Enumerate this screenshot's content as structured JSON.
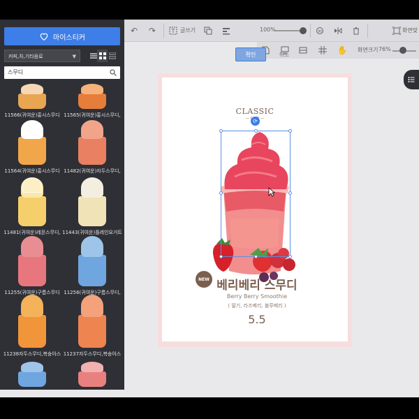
{
  "sidebar": {
    "sticker_button": "마이스티커",
    "category": "커피,차,기타음료",
    "search_value": "스무디",
    "items": [
      {
        "label": "11566(귀여운)홍시스무디",
        "top_color": "#f6d7b4",
        "body_color": "#e8a552"
      },
      {
        "label": "11565(귀여운)홍시스무디,",
        "top_color": "#f6b27a",
        "body_color": "#e67d3a"
      },
      {
        "label": "11564(귀여운)홍시스무디",
        "top_color": "#ffffff",
        "body_color": "#f2a64a"
      },
      {
        "label": "11482(귀여운)자두스무디,",
        "top_color": "#f2a48a",
        "body_color": "#e98062"
      },
      {
        "label": "11481(귀여운)레몬스무디,",
        "top_color": "#fbe7a6",
        "body_color": "#f5cf6b"
      },
      {
        "label": "11443(귀여운)플레인요거트",
        "top_color": "#f3eedf",
        "body_color": "#f1e3b8"
      },
      {
        "label": "11255(귀여운)구름스무디",
        "top_color": "#e88e92",
        "body_color": "#e7777c"
      },
      {
        "label": "11256(귀여운)구름스무디,",
        "top_color": "#9ec4ea",
        "body_color": "#6fa6e0"
      },
      {
        "label": "11238자두스무디,복숭아스",
        "top_color": "#f4b25a",
        "body_color": "#f1953a"
      },
      {
        "label": "11237자두스무디,복숭아스",
        "top_color": "#f3a27c",
        "body_color": "#ee8450"
      },
      {
        "label": "",
        "top_color": "#9ec4ea",
        "body_color": "#6fa6e0"
      },
      {
        "label": "",
        "top_color": "#f3b0b0",
        "body_color": "#e98080"
      }
    ]
  },
  "toolbar": {
    "text_label": "글쓰기",
    "zoom_value": "100%",
    "confirm": "확인",
    "cancel": "취소",
    "screen_fit": "화면맞",
    "screen_size": "화면크기",
    "screen_size_value": "76%"
  },
  "product": {
    "brand": "CLASSIC",
    "brand_sub": "— CAFE —",
    "badge": "NEW",
    "title": "베리베리 스무디",
    "subtitle": "Berry Berry Smoothie",
    "ingredients": "( 딸기, 라즈베리, 블루베리 )",
    "price": "5.5"
  },
  "colors": {
    "accent": "#3d7ee8",
    "brand_brown": "#7a5f4f",
    "sidebar_bg": "#2f3036",
    "page_border": "#f6dede"
  }
}
